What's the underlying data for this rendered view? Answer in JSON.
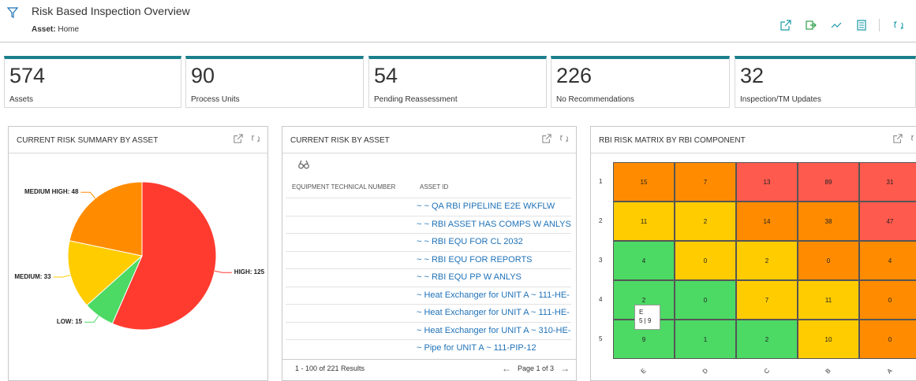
{
  "header": {
    "title": "Risk Based Inspection Overview",
    "crumb_label": "Asset:",
    "crumb_value": "Home",
    "toolbar": [
      "open-external-icon",
      "export-icon",
      "trend-icon",
      "calculator-icon",
      "refresh-icon"
    ]
  },
  "kpis": [
    {
      "value": "574",
      "label": "Assets"
    },
    {
      "value": "90",
      "label": "Process Units"
    },
    {
      "value": "54",
      "label": "Pending Reassessment"
    },
    {
      "value": "226",
      "label": "No Recommendations"
    },
    {
      "value": "32",
      "label": "Inspection/TM Updates"
    }
  ],
  "colors": {
    "accent": "#1a7f8c",
    "link": "#1f72b8",
    "high": "#ff3b30",
    "medium_high": "#ff8c00",
    "medium": "#ffcc00",
    "low": "#4cd964"
  },
  "panels": {
    "summary": {
      "title": "CURRENT RISK SUMMARY BY ASSET"
    },
    "risk_by_asset": {
      "title": "CURRENT RISK BY ASSET"
    },
    "matrix": {
      "title": "RBI RISK MATRIX BY RBI COMPONENT"
    }
  },
  "chart_data": {
    "type": "pie",
    "slices": [
      {
        "label": "HIGH: 125",
        "name": "HIGH",
        "value": 125,
        "color": "#ff3b30"
      },
      {
        "label": "LOW: 15",
        "name": "LOW",
        "value": 15,
        "color": "#4cd964"
      },
      {
        "label": "MEDIUM: 33",
        "name": "MEDIUM",
        "value": 33,
        "color": "#ffcc00"
      },
      {
        "label": "MEDIUM HIGH: 48",
        "name": "MEDIUM HIGH",
        "value": 48,
        "color": "#ff8c00"
      }
    ]
  },
  "table": {
    "columns": [
      "EQUIPMENT TECHNICAL NUMBER",
      "ASSET ID"
    ],
    "rows": [
      "~ ~ QA RBI PIPELINE E2E WKFLW",
      "~ ~ RBI ASSET HAS COMPS W ANLYS",
      "~ ~ RBI EQU FOR CL 2032",
      "~ ~ RBI EQU FOR REPORTS",
      "~ ~ RBI EQU PP W ANLYS",
      "~ Heat Exchanger for UNIT A ~ 111-HE-",
      "~ Heat Exchanger for UNIT A ~ 111-HE-",
      "~ Heat Exchanger for UNIT A ~ 310-HE-",
      "~ Pipe for UNIT A ~ 111-PIP-12"
    ],
    "results": "1 - 100 of 221 Results",
    "page": "Page 1 of 3"
  },
  "matrix": {
    "row_labels": [
      "1",
      "2",
      "3",
      "4",
      "5"
    ],
    "col_labels": [
      "E",
      "D",
      "C",
      "B",
      "A"
    ],
    "cells": [
      [
        {
          "v": "15",
          "c": "#ff8c00"
        },
        {
          "v": "7",
          "c": "#ff8c00"
        },
        {
          "v": "13",
          "c": "#ff5a4e"
        },
        {
          "v": "89",
          "c": "#ff5a4e"
        },
        {
          "v": "31",
          "c": "#ff5a4e"
        }
      ],
      [
        {
          "v": "11",
          "c": "#ffcc00"
        },
        {
          "v": "2",
          "c": "#ffcc00"
        },
        {
          "v": "14",
          "c": "#ff8c00"
        },
        {
          "v": "38",
          "c": "#ff8c00"
        },
        {
          "v": "47",
          "c": "#ff5a4e"
        }
      ],
      [
        {
          "v": "4",
          "c": "#4cd964"
        },
        {
          "v": "0",
          "c": "#ffcc00"
        },
        {
          "v": "2",
          "c": "#ffcc00"
        },
        {
          "v": "0",
          "c": "#ff8c00"
        },
        {
          "v": "4",
          "c": "#ff8c00"
        }
      ],
      [
        {
          "v": "2",
          "c": "#4cd964"
        },
        {
          "v": "0",
          "c": "#4cd964"
        },
        {
          "v": "7",
          "c": "#ffcc00"
        },
        {
          "v": "11",
          "c": "#ffcc00"
        },
        {
          "v": "0",
          "c": "#ff8c00"
        }
      ],
      [
        {
          "v": "9",
          "c": "#4cd964"
        },
        {
          "v": "1",
          "c": "#4cd964"
        },
        {
          "v": "2",
          "c": "#4cd964"
        },
        {
          "v": "10",
          "c": "#ffcc00"
        },
        {
          "v": "0",
          "c": "#ff8c00"
        }
      ]
    ],
    "tooltip": {
      "line1": "E",
      "line2": "5 | 9"
    }
  }
}
